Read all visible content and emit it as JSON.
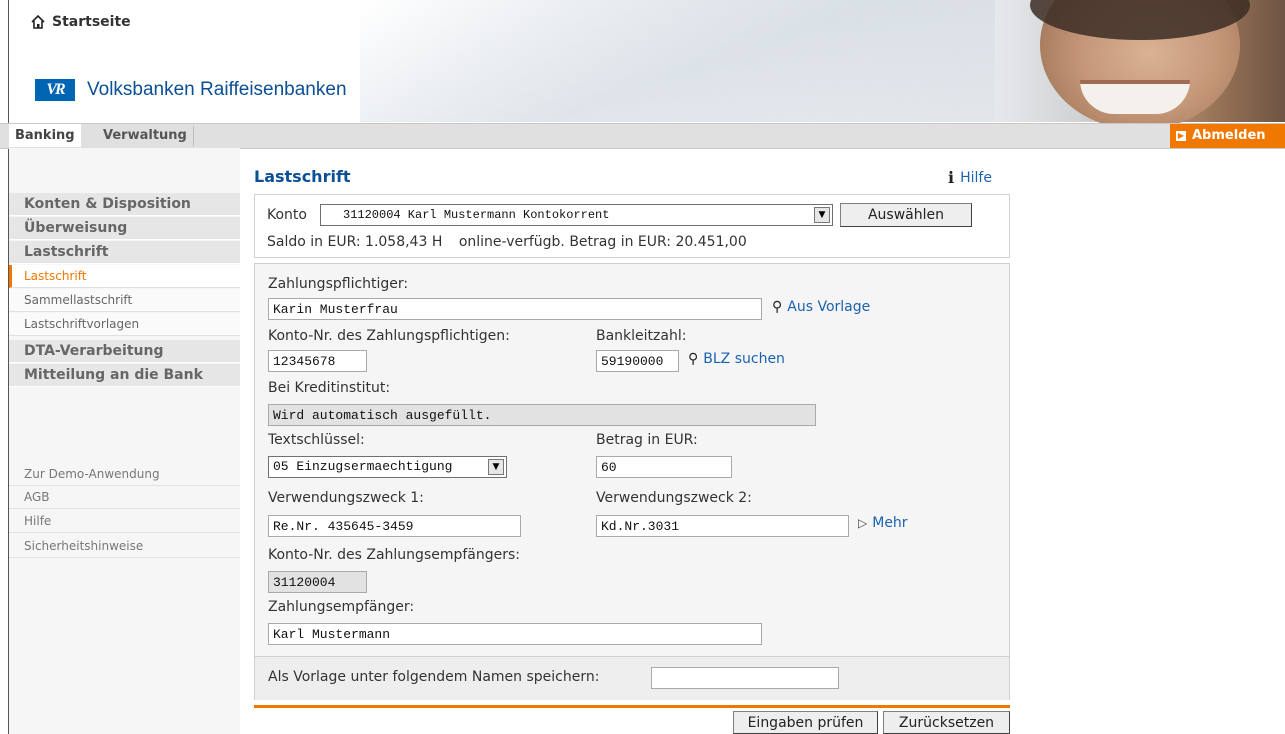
{
  "header": {
    "home_label": "Startseite",
    "bank_name": "Volksbanken Raiffeisenbanken",
    "logo_mark": "VR"
  },
  "nav": {
    "tabs": [
      "Banking",
      "Verwaltung"
    ],
    "logout_label": "Abmelden"
  },
  "sidebar": {
    "sections": [
      {
        "label": "Konten & Disposition"
      },
      {
        "label": "Überweisung"
      },
      {
        "label": "Lastschrift"
      }
    ],
    "subitems": [
      {
        "label": "Lastschrift"
      },
      {
        "label": "Sammellastschrift"
      },
      {
        "label": "Lastschriftvorlagen"
      }
    ],
    "sections2": [
      {
        "label": "DTA-Verarbeitung"
      },
      {
        "label": "Mitteilung an die Bank"
      }
    ],
    "links": [
      {
        "label": "Zur Demo-Anwendung"
      },
      {
        "label": "AGB"
      },
      {
        "label": "Hilfe"
      },
      {
        "label": "Sicherheitshinweise"
      }
    ]
  },
  "main": {
    "title": "Lastschrift",
    "help_label": "Hilfe",
    "konto": {
      "label": "Konto",
      "selected": "31120004  Karl Mustermann  Kontokorrent",
      "select_button": "Auswählen",
      "saldo_label": "Saldo in EUR:",
      "saldo_value": "1.058,43 H",
      "available_label": "online-verfügb. Betrag in EUR:",
      "available_value": "20.451,00"
    },
    "form": {
      "payer_label": "Zahlungspflichtiger:",
      "payer_value": "Karin Musterfrau",
      "template_link": "Aus Vorlage",
      "payer_account_label": "Konto-Nr. des Zahlungspflichtigen:",
      "payer_account_value": "12345678",
      "blz_label": "Bankleitzahl:",
      "blz_value": "59190000",
      "blz_search_link": "BLZ suchen",
      "institute_label": "Bei Kreditinstitut:",
      "institute_value": "Wird automatisch ausgefüllt.",
      "textkey_label": "Textschlüssel:",
      "textkey_value": "05 Einzugsermaechtigung",
      "amount_label": "Betrag in EUR:",
      "amount_value": "60",
      "purpose1_label": "Verwendungszweck 1:",
      "purpose1_value": "Re.Nr. 435645-3459",
      "purpose2_label": "Verwendungszweck 2:",
      "purpose2_value": "Kd.Nr.3031",
      "more_link": "Mehr",
      "payee_account_label": "Konto-Nr. des Zahlungsempfängers:",
      "payee_account_value": "31120004",
      "payee_label": "Zahlungsempfänger:",
      "payee_value": "Karl Mustermann"
    },
    "save_template_label": "Als Vorlage unter folgendem Namen speichern:",
    "save_template_value": "",
    "buttons": {
      "check": "Eingaben prüfen",
      "reset": "Zurücksetzen"
    }
  },
  "colors": {
    "accent_orange": "#f07800",
    "brand_blue": "#0b4f95",
    "link_blue": "#1a62b0"
  }
}
